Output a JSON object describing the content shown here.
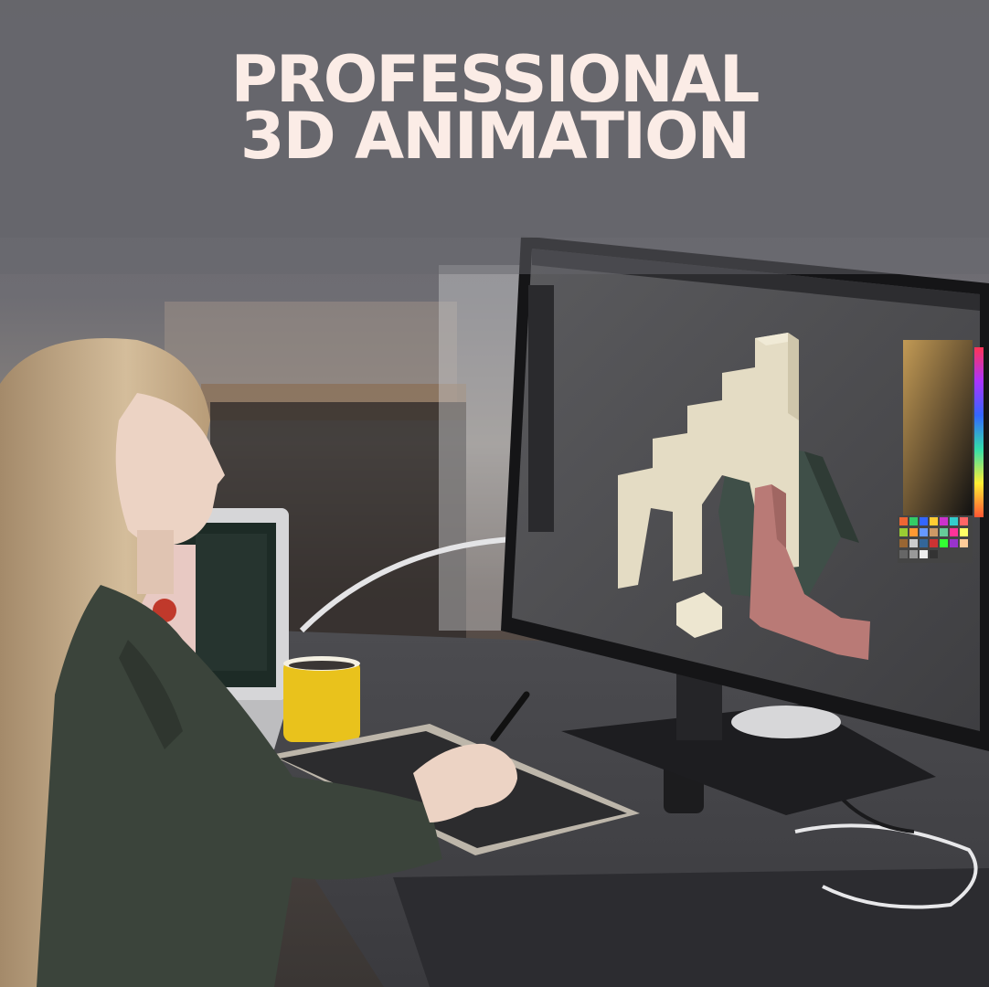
{
  "headline": {
    "line1": "PROFESSIONAL",
    "line2": "3D ANIMATION"
  },
  "scene": {
    "description_icons": [
      "woman-artist",
      "desktop-monitor",
      "laptop",
      "yellow-mug",
      "drawing-tablet",
      "stylus",
      "3d-shapes-render",
      "color-picker-panel"
    ],
    "colors": {
      "background_top": "#6a6a70",
      "title_text": "#fbece6",
      "arch_cream": "#e4dcc4",
      "hexagon_green": "#3f4f48",
      "ramp_pink": "#b97a76",
      "mug_yellow": "#e9c21c",
      "hoodie_green": "#3b443b",
      "hair_blonde": "#c9b08e"
    }
  }
}
